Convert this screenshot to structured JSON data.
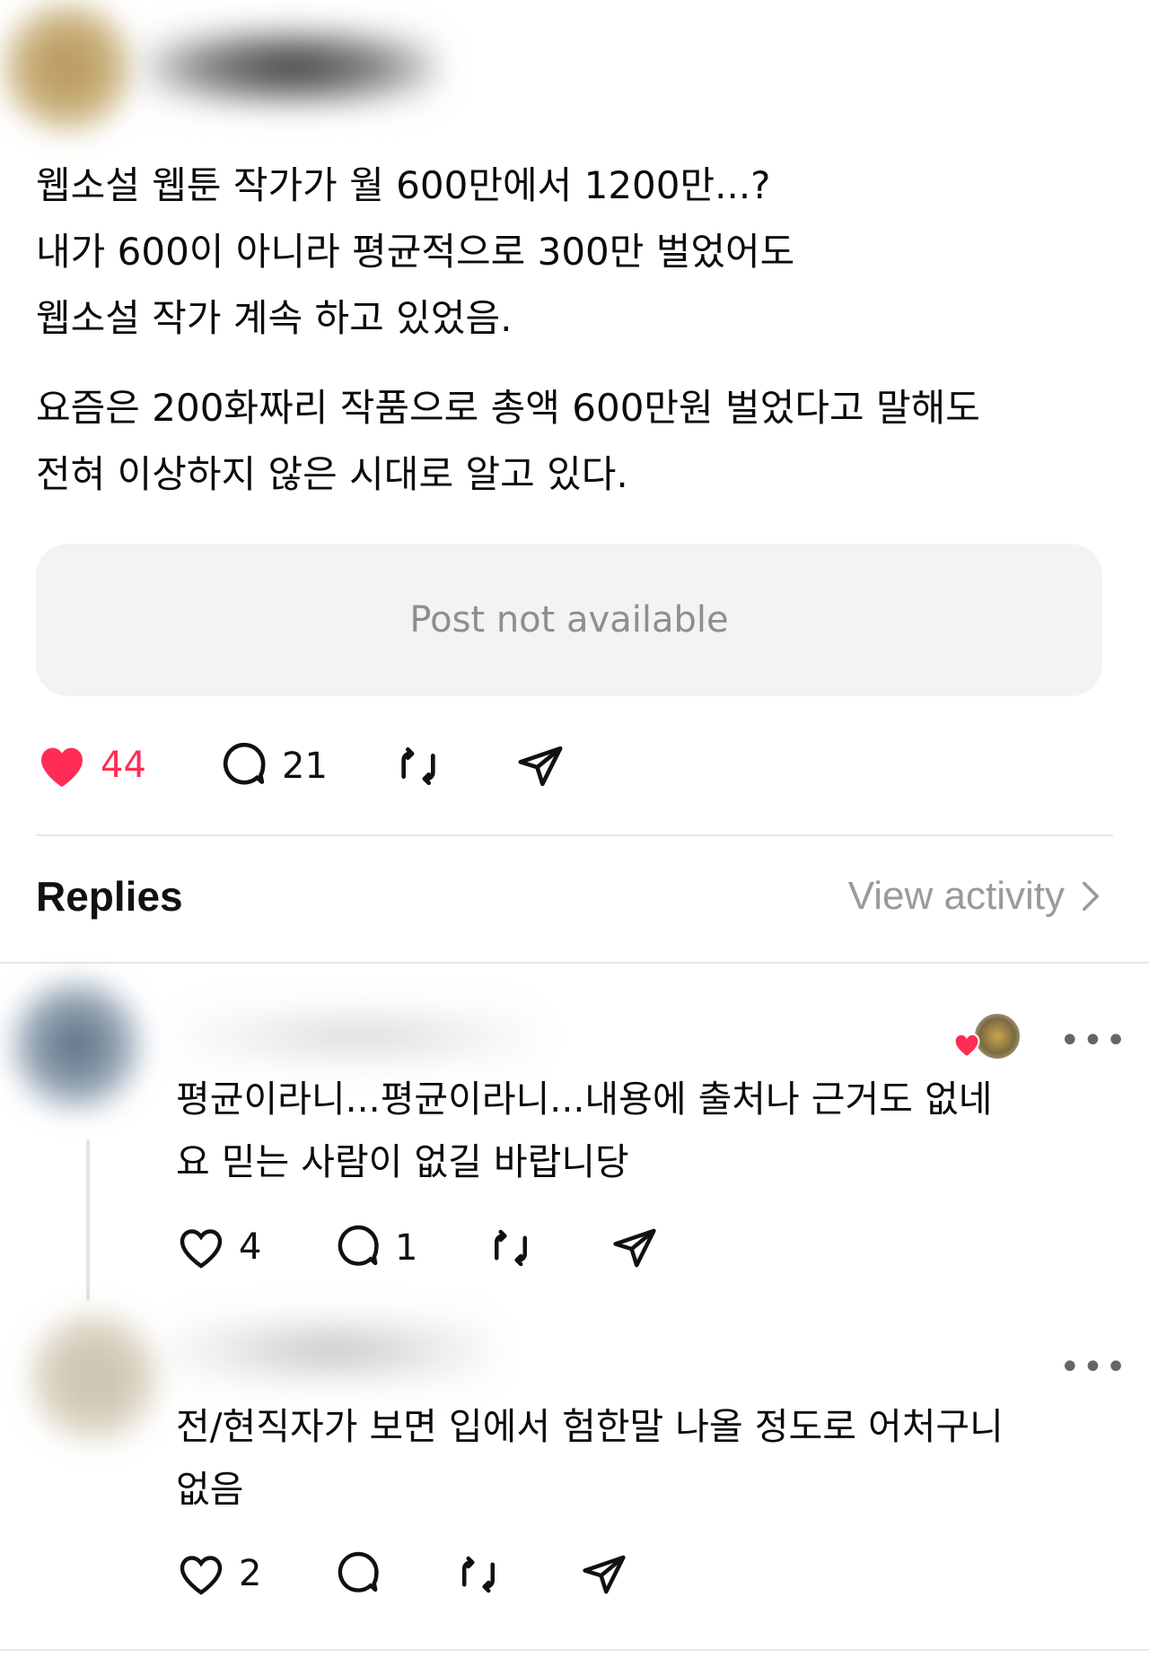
{
  "post": {
    "paragraph1": [
      "웹소설 웹툰 작가가 월 600만에서 1200만...?",
      "내가 600이 아니라 평균적으로 300만 벌었어도",
      "웹소설 작가 계속 하고 있었음."
    ],
    "paragraph2": [
      "요즘은 200화짜리 작품으로 총액 600만원 벌었다고 말해도",
      "전혀 이상하지 않은 시대로 알고 있다."
    ],
    "quoted_post": "Post not available",
    "likes": "44",
    "replies_count": "21",
    "liked": true
  },
  "replies_header": {
    "title": "Replies",
    "view_activity": "View activity"
  },
  "replies": [
    {
      "text": [
        "평균이라니...평균이라니...내용에 출처나 근거도 없네",
        "요 믿는 사람이 없길 바랍니당"
      ],
      "likes": "4",
      "replies_count": "1",
      "liked_by_author": true
    },
    {
      "text": [
        "전/현직자가 보면 입에서 험한말 나올 정도로 어처구니",
        "없음"
      ],
      "likes": "2"
    }
  ],
  "colors": {
    "like_red": "#ff2d55",
    "muted_text": "#8e8e8e",
    "divider": "#e6e6e6"
  },
  "icons": [
    "heart-icon",
    "comment-icon",
    "repost-icon",
    "share-icon",
    "chevron-right-icon",
    "more-icon"
  ]
}
